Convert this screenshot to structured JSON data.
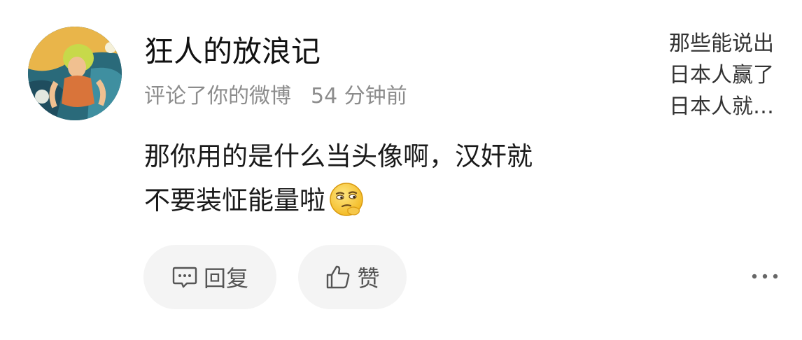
{
  "comment": {
    "username": "狂人的放浪记",
    "action": "评论了你的微博",
    "time": "54 分钟前",
    "text_line1": "那你用的是什么当头像啊，汉奸就",
    "text_line2": "不要装怔能量啦",
    "emoji": "thinking-face-emoji"
  },
  "actions": {
    "reply_label": "回复",
    "like_label": "赞",
    "reply_icon": "comment-bubble-icon",
    "like_icon": "thumbs-up-icon",
    "more_icon": "more-dots-icon"
  },
  "preview": {
    "line1": "那些能说出",
    "line2": "日本人赢了",
    "line3": "日本人就…"
  },
  "colors": {
    "text_primary": "#111111",
    "text_secondary": "#8c8c8c",
    "button_bg": "#f4f4f4",
    "button_text": "#555555"
  }
}
